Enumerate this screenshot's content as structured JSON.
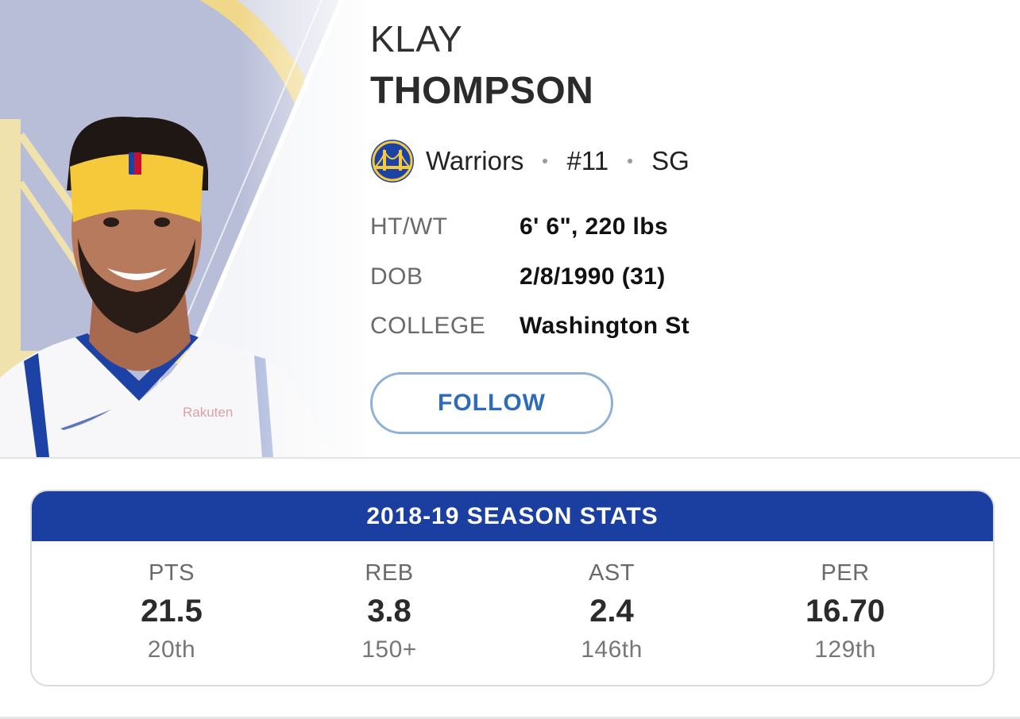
{
  "player": {
    "first_name": "KLAY",
    "last_name": "THOMPSON",
    "team": "Warriors",
    "number": "#11",
    "position": "SG"
  },
  "attributes": [
    {
      "label": "HT/WT",
      "value": "6' 6\", 220 lbs"
    },
    {
      "label": "DOB",
      "value": "2/8/1990 (31)"
    },
    {
      "label": "COLLEGE",
      "value": "Washington St"
    }
  ],
  "follow_label": "FOLLOW",
  "jersey_sponsor": "Rakuten",
  "stats": {
    "title": "2018-19 SEASON STATS",
    "items": [
      {
        "label": "PTS",
        "value": "21.5",
        "rank": "20th"
      },
      {
        "label": "REB",
        "value": "3.8",
        "rank": "150+"
      },
      {
        "label": "AST",
        "value": "2.4",
        "rank": "146th"
      },
      {
        "label": "PER",
        "value": "16.70",
        "rank": "129th"
      }
    ]
  },
  "colors": {
    "team_blue": "#1b3fa0",
    "team_gold": "#f5c93a",
    "follow_text": "#2e6bb8",
    "follow_border": "#8fb1d9"
  },
  "icons": {
    "team_logo": "warriors-bridge-logo",
    "separator": "middle-dot"
  }
}
